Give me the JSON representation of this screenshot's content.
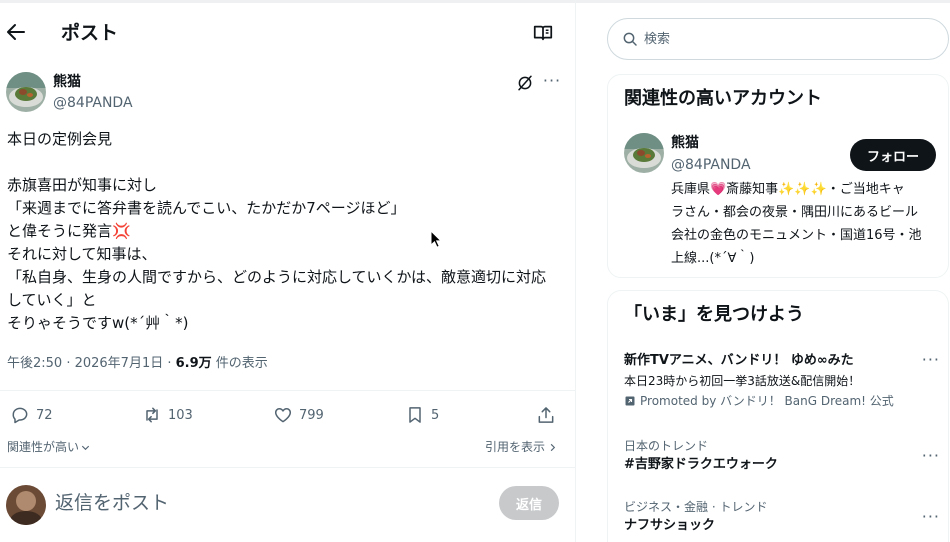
{
  "header": {
    "title": "ポスト"
  },
  "post": {
    "author_name": "熊猫",
    "author_handle": "@84PANDA",
    "lines": [
      "本日の定例会見",
      "",
      "赤旗喜田が知事に対し",
      "「来週までに答弁書を読んでこい、たかだか7ページほど」",
      "と偉そうに発言💢",
      "それに対して知事は、",
      "「私自身、生身の人間ですから、どのように対応していくかは、敵意適切に対応",
      "していく」と",
      "そりゃそうですw(*´艸｀*)"
    ],
    "time": "午後2:50 · 2026年7月1日 · ",
    "views_count": "6.9万",
    "views_label": " 件の表示"
  },
  "actions": {
    "replies": "72",
    "reposts": "103",
    "likes": "799",
    "bookmarks": "5"
  },
  "subbar": {
    "relevance": "関連性が高い",
    "quotes": "引用を表示"
  },
  "reply": {
    "placeholder": "返信をポスト",
    "button_label": "返信"
  },
  "sidebar": {
    "search_placeholder": "検索",
    "related": {
      "title": "関連性の高いアカウント",
      "name": "熊猫",
      "handle": "@84PANDA",
      "follow_label": "フォロー",
      "bio_lines": [
        "兵庫県💗斎藤知事✨✨✨・ご当地キャ",
        "ラさん・都会の夜景・隅田川にあるビール",
        "会社の金色のモニュメント・国道16号・池",
        "上線...(*´∀｀)"
      ]
    },
    "now": {
      "title": "「いま」を見つけよう",
      "trends": [
        {
          "category": "",
          "title": "新作TVアニメ、バンドリ！ ゆめ∞みた",
          "description": "本日23時から初回一挙3話放送&配信開始！",
          "promoted": "Promoted by バンドリ！ BanG Dream! 公式"
        },
        {
          "category": "日本のトレンド",
          "title": "#吉野家ドラクエウォーク"
        },
        {
          "category": "ビジネス・金融 · トレンド",
          "title": "ナフサショック"
        }
      ]
    }
  },
  "colors": {
    "text": "#0f1419",
    "muted": "#536471",
    "border": "#eff3f4",
    "follow_bg": "#0f1419",
    "reply_disabled": "#c7c9cb"
  },
  "icons": [
    "back-arrow-icon",
    "reader-icon",
    "grok-icon",
    "more-icon",
    "reply-icon",
    "repost-icon",
    "heart-icon",
    "bookmark-icon",
    "share-icon",
    "search-icon",
    "promoted-icon",
    "chevron-down-icon",
    "chevron-right-icon"
  ]
}
